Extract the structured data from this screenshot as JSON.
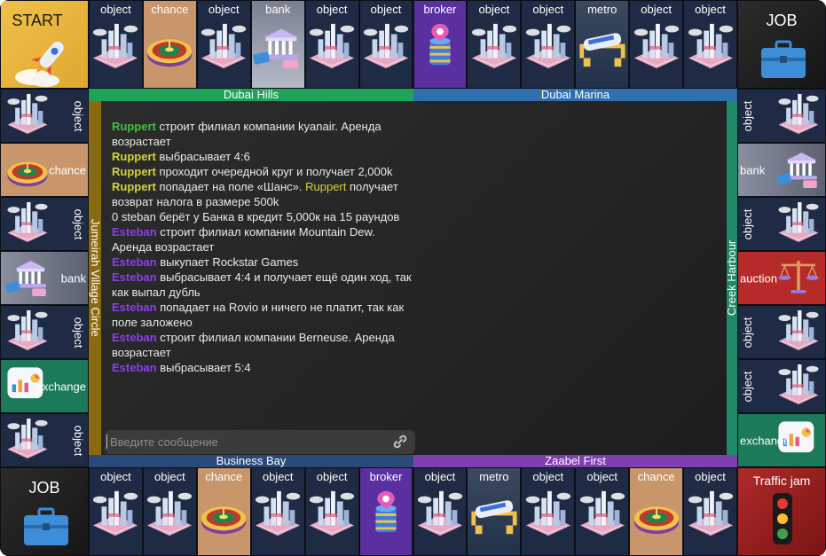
{
  "colors": {
    "ruppert": "#3fc43f",
    "ruppert_alt": "#d4d43a",
    "esteban": "#8a3fe8",
    "green_group": "#1fa35a",
    "blue_group": "#2f6fb0",
    "brown_group": "#8a6a10",
    "teal_group": "#1f8a6a",
    "purple_group": "#7f3fb0"
  },
  "corners": {
    "start": {
      "label": "START",
      "icon": "rocket-icon"
    },
    "job_top": {
      "label": "JOB",
      "icon": "briefcase-icon"
    },
    "job_bottom": {
      "label": "JOB",
      "icon": "briefcase-icon"
    },
    "traffic": {
      "label": "Traffic jam",
      "icon": "traffic-light-icon"
    }
  },
  "top_row": [
    {
      "label": "object",
      "icon": "city-icon"
    },
    {
      "label": "chance",
      "icon": "roulette-icon"
    },
    {
      "label": "object",
      "icon": "city-icon"
    },
    {
      "label": "bank",
      "icon": "bank-icon"
    },
    {
      "label": "object",
      "icon": "city-icon"
    },
    {
      "label": "object",
      "icon": "city-icon"
    },
    {
      "label": "broker",
      "icon": "broker-icon"
    },
    {
      "label": "object",
      "icon": "city-icon"
    },
    {
      "label": "object",
      "icon": "city-icon"
    },
    {
      "label": "metro",
      "icon": "metro-icon"
    },
    {
      "label": "object",
      "icon": "city-icon"
    },
    {
      "label": "object",
      "icon": "city-icon"
    }
  ],
  "bottom_row": [
    {
      "label": "object",
      "icon": "city-icon"
    },
    {
      "label": "object",
      "icon": "city-icon"
    },
    {
      "label": "chance",
      "icon": "roulette-icon"
    },
    {
      "label": "object",
      "icon": "city-icon"
    },
    {
      "label": "object",
      "icon": "city-icon"
    },
    {
      "label": "broker",
      "icon": "broker-icon"
    },
    {
      "label": "object",
      "icon": "city-icon"
    },
    {
      "label": "metro",
      "icon": "metro-icon"
    },
    {
      "label": "object",
      "icon": "city-icon"
    },
    {
      "label": "object",
      "icon": "city-icon"
    },
    {
      "label": "chance",
      "icon": "roulette-icon"
    },
    {
      "label": "object",
      "icon": "city-icon"
    }
  ],
  "left_col": [
    {
      "label": "object",
      "icon": "city-icon"
    },
    {
      "label": "chance",
      "icon": "roulette-icon"
    },
    {
      "label": "object",
      "icon": "city-icon"
    },
    {
      "label": "bank",
      "icon": "bank-icon"
    },
    {
      "label": "object",
      "icon": "city-icon"
    },
    {
      "label": "exchange",
      "icon": "exchange-icon"
    },
    {
      "label": "object",
      "icon": "city-icon"
    }
  ],
  "right_col": [
    {
      "label": "object",
      "icon": "city-icon"
    },
    {
      "label": "bank",
      "icon": "bank-icon"
    },
    {
      "label": "object",
      "icon": "city-icon"
    },
    {
      "label": "auction",
      "icon": "scales-icon"
    },
    {
      "label": "object",
      "icon": "city-icon"
    },
    {
      "label": "object",
      "icon": "city-icon"
    },
    {
      "label": "exchange",
      "icon": "exchange-icon"
    }
  ],
  "groups": {
    "top_left": "Dubai Hills",
    "top_right": "Dubai Marina",
    "bottom_left": "Business Bay",
    "bottom_right": "Zaabel First",
    "left": "Jumeirah Village Circle",
    "right": "Creek Harbour"
  },
  "chat": {
    "messages": [
      {
        "player": "Ruppert",
        "color": "#3fc43f",
        "text": " строит филиал компании kyanair. Аренда возрастает"
      },
      {
        "player": "Ruppert",
        "color": "#d4d43a",
        "text": " выбрасывает 4:6"
      },
      {
        "player": "Ruppert",
        "color": "#d4d43a",
        "text": " проходит очередной круг и получает 2,000k"
      },
      {
        "player": "Ruppert",
        "color": "#d4d43a",
        "text": " попадает на поле «Шанс». ",
        "player2": "Ruppert",
        "text2": " получает возврат налога в размере 500k"
      },
      {
        "player": "",
        "color": "#eaeaea",
        "text": "0 steban берёт у Банка в кредит 5,000к на 15 раундов"
      },
      {
        "player": "Esteban",
        "color": "#8a3fe8",
        "text": " строит филиал компании Mountain Dew. Аренда возрастает"
      },
      {
        "player": "Esteban",
        "color": "#8a3fe8",
        "text": " выкупает Rockstar Games"
      },
      {
        "player": "Esteban",
        "color": "#8a3fe8",
        "text": " выбрасывает 4:4 и получает ещё один ход, так как выпал дубль"
      },
      {
        "player": "Esteban",
        "color": "#8a3fe8",
        "text": " попадает на Rovio и ничего не платит, так как поле заложено"
      },
      {
        "player": "Esteban",
        "color": "#8a3fe8",
        "text": " строит филиал компании Berneuse. Аренда возрастает"
      },
      {
        "player": "Esteban",
        "color": "#8a3fe8",
        "text": " выбрасывает 5:4"
      }
    ],
    "input_placeholder": "Введите сообщение",
    "attach_icon": "link-icon"
  }
}
